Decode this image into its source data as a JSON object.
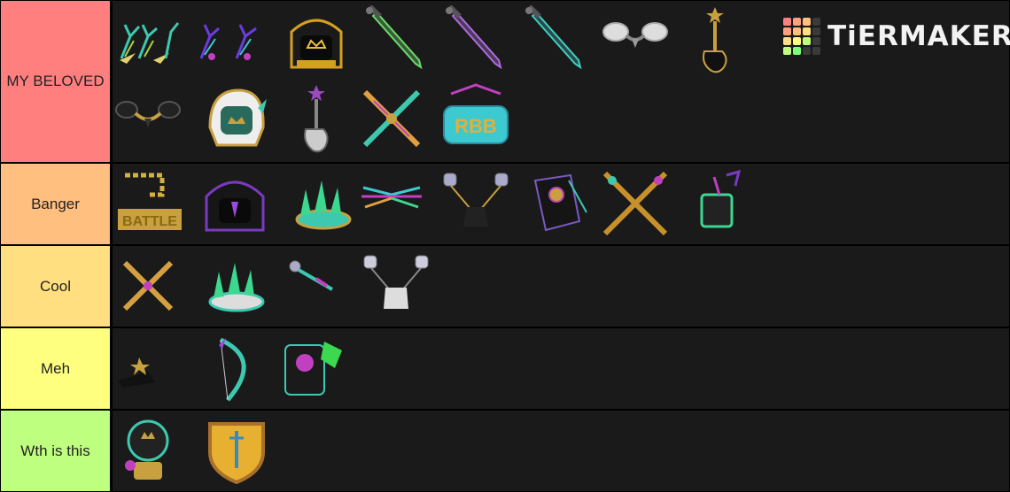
{
  "logo": {
    "text": "TiERMAKER",
    "grid_colors": [
      "#ff7f7f",
      "#ff9f7f",
      "#ffbf7f",
      "#3a3a3a",
      "#ff9f7f",
      "#ffbf7f",
      "#ffdf7f",
      "#3a3a3a",
      "#ffdf7f",
      "#ffff7f",
      "#bfff7f",
      "#3a3a3a",
      "#bfff7f",
      "#7fff7f",
      "#3a3a3a",
      "#3a3a3a"
    ]
  },
  "tiers": [
    {
      "label": "MY BELOVED",
      "color": "#ff7f7f",
      "items": [
        "antlers-icon",
        "antlers-icon",
        "crown-hood-icon",
        "sword-icon",
        "sword-icon",
        "sword-icon",
        "headphones-icon",
        "guitar-icon",
        "headphones-icon",
        "helmet-icon",
        "guitar-icon",
        "crossed-swords-icon",
        "rbb-boombox-icon"
      ]
    },
    {
      "label": "Banger",
      "color": "#ffbf7f",
      "items": [
        "battle-chain-icon",
        "hood-icon",
        "crown-icon",
        "wings-icon",
        "microphones-icon",
        "speaker-icon",
        "crossed-swords-icon",
        "drink-icon"
      ]
    },
    {
      "label": "Cool",
      "color": "#ffdf7f",
      "items": [
        "crossed-swords-icon",
        "crown-icon",
        "microphone-icon",
        "microphones-icon"
      ]
    },
    {
      "label": "Meh",
      "color": "#ffff7f",
      "items": [
        "cap-icon",
        "bow-icon",
        "mask-icon"
      ]
    },
    {
      "label": "Wth is this",
      "color": "#bfff7f",
      "items": [
        "orb-icon",
        "shield-icon"
      ]
    }
  ]
}
